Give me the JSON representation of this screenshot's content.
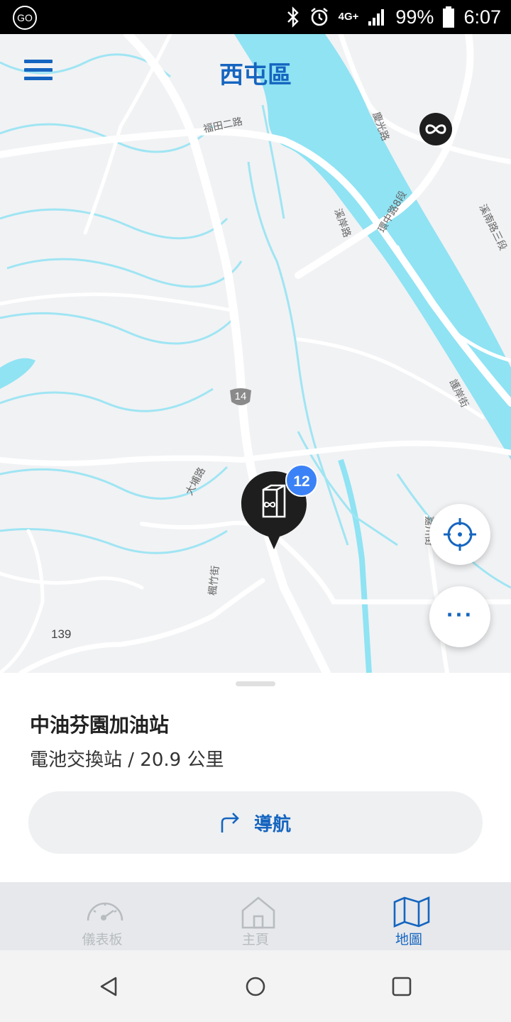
{
  "status_bar": {
    "left_badge": "GO",
    "network": "4G+",
    "battery": "99%",
    "time": "6:07"
  },
  "header": {
    "district": "西屯區"
  },
  "map": {
    "road_labels": [
      "福田二路",
      "慶光路",
      "環中路8段",
      "溪岸路",
      "溪南路三段",
      "護岸街",
      "大埔路",
      "楓竹街",
      "嘉川街"
    ],
    "route_shield": "14",
    "route_number": "139",
    "pin_badge_count": "12",
    "colors": {
      "water": "#8fe3f3",
      "background": "#f1f2f4",
      "road": "#ffffff",
      "accent": "#1565c0"
    }
  },
  "sheet": {
    "station_name": "中油芬園加油站",
    "station_detail": "電池交換站 / 20.9 公里",
    "navigate_label": "導航"
  },
  "tabs": [
    {
      "label": "儀表板",
      "icon": "speedometer-icon",
      "active": false
    },
    {
      "label": "主頁",
      "icon": "home-icon",
      "active": false
    },
    {
      "label": "地圖",
      "icon": "map-icon",
      "active": true
    }
  ]
}
